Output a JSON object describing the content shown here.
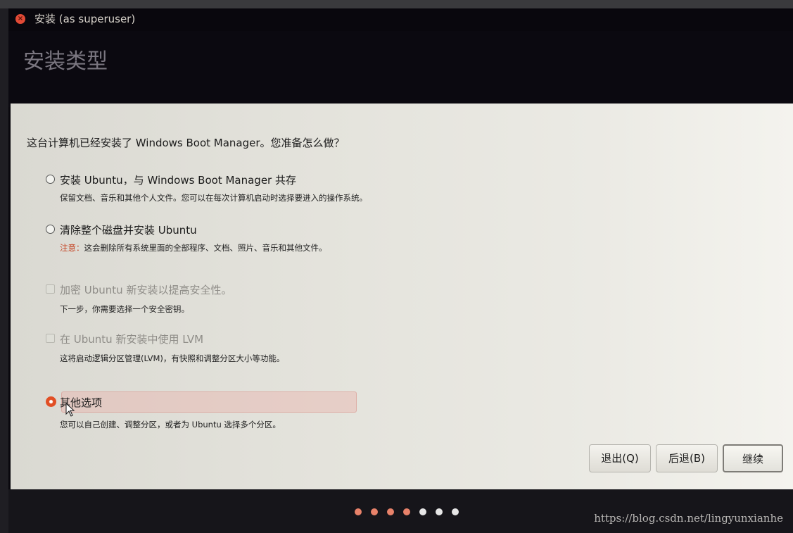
{
  "window": {
    "title": "安装 (as superuser)",
    "close_glyph": "×"
  },
  "page": {
    "title": "安装类型"
  },
  "content": {
    "question": "这台计算机已经安装了 Windows Boot Manager。您准备怎么做？",
    "options": [
      {
        "kind": "radio",
        "label": "安装 Ubuntu，与 Windows Boot Manager 共存",
        "description": "保留文档、音乐和其他个人文件。您可以在每次计算机启动时选择要进入的操作系统。",
        "selected": false,
        "enabled": true
      },
      {
        "kind": "radio",
        "label": "清除整个磁盘并安装 Ubuntu",
        "warning_prefix": "注意：",
        "description": "这会删除所有系统里面的全部程序、文档、照片、音乐和其他文件。",
        "selected": false,
        "enabled": true
      },
      {
        "kind": "checkbox",
        "label": "加密 Ubuntu 新安装以提高安全性。",
        "description": "下一步，你需要选择一个安全密钥。",
        "checked": false,
        "enabled": false
      },
      {
        "kind": "checkbox",
        "label": "在 Ubuntu 新安装中使用 LVM",
        "description": "这将启动逻辑分区管理(LVM)，有快照和调整分区大小等功能。",
        "checked": false,
        "enabled": false
      },
      {
        "kind": "radio",
        "label": "其他选项",
        "description": "您可以自己创建、调整分区，或者为 Ubuntu 选择多个分区。",
        "selected": true,
        "enabled": true
      }
    ]
  },
  "buttons": {
    "quit": "退出(Q)",
    "back": "后退(B)",
    "continue": "继续"
  },
  "progress": {
    "total_steps": 7,
    "completed_steps": 4,
    "active_color": "#e8826a",
    "inactive_color": "#e6e6e6"
  },
  "watermark": "https://blog.csdn.net/lingyunxianhe",
  "colors": {
    "accent": "#e14f25",
    "warning": "#c44424"
  }
}
